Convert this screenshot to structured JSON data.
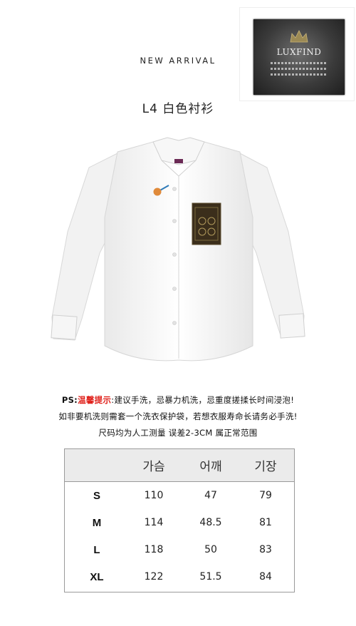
{
  "logo": {
    "brand": "LUXFIND"
  },
  "header": {
    "new_arrival": "NEW ARRIVAL",
    "title": "L4 白色衬衫"
  },
  "product_image": {
    "description": "white long-sleeve shirt with patterned chest pocket"
  },
  "notes": {
    "line1_ps": "PS:",
    "line1_warm": "温馨提示",
    "line1_rest": ":建议手洗，忌暴力机洗，忌重度搓揉长时间浸泡!",
    "line2": "如非要机洗则需套一个洗衣保护袋，若想衣服寿命长请务必手洗!",
    "line3": "尺码均为人工测量 误差2-3CM 属正常范围"
  },
  "size_table": {
    "headers": [
      "",
      "가슴",
      "어깨",
      "기장"
    ],
    "rows": [
      {
        "size": "S",
        "chest": "110",
        "shoulder": "47",
        "length": "79"
      },
      {
        "size": "M",
        "chest": "114",
        "shoulder": "48.5",
        "length": "81"
      },
      {
        "size": "L",
        "chest": "118",
        "shoulder": "50",
        "length": "83"
      },
      {
        "size": "XL",
        "chest": "122",
        "shoulder": "51.5",
        "length": "84"
      }
    ]
  },
  "colors": {
    "accent_red": "#e0211b",
    "header_bg": "#ebebeb"
  }
}
